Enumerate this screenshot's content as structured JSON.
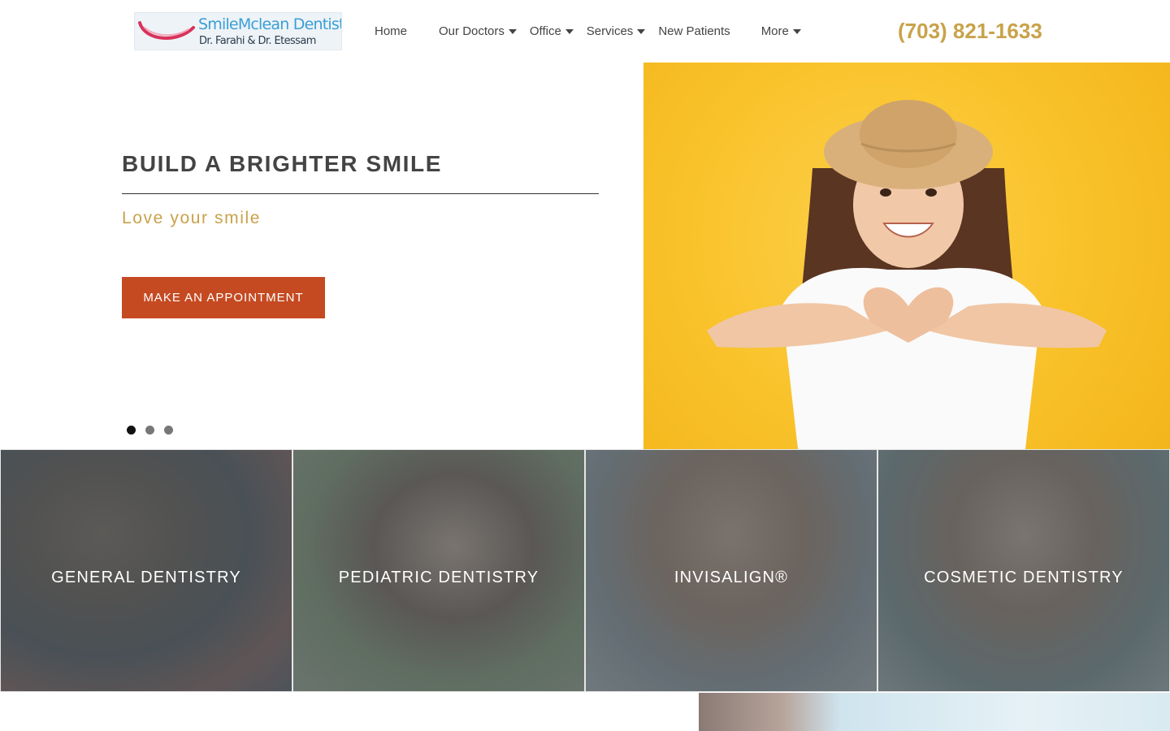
{
  "header": {
    "logo": {
      "brand": "SmileMclean Dentistry",
      "doctors": "Dr. Farahi & Dr. Etessam",
      "icon": "smile-icon"
    },
    "nav": [
      {
        "label": "Home",
        "dropdown": false
      },
      {
        "label": "Our Doctors",
        "dropdown": true
      },
      {
        "label": "Office",
        "dropdown": true
      },
      {
        "label": "Services",
        "dropdown": true
      },
      {
        "label": "New Patients",
        "dropdown": false
      },
      {
        "label": "More",
        "dropdown": true
      }
    ],
    "phone": "(703) 821-1633"
  },
  "hero": {
    "title": "BUILD A BRIGHTER SMILE",
    "subtitle": "Love your smile",
    "cta_label": "MAKE AN APPOINTMENT",
    "slides": 3,
    "active_slide": 1
  },
  "services": [
    {
      "label": "GENERAL DENTISTRY"
    },
    {
      "label": "PEDIATRIC DENTISTRY"
    },
    {
      "label": "INVISALIGN®"
    },
    {
      "label": "COSMETIC DENTISTRY"
    }
  ],
  "colors": {
    "accent_gold": "#c9a24a",
    "cta_red": "#c54a22",
    "hero_yellow": "#f9c22a",
    "tile_overlay": "#555a5c"
  }
}
